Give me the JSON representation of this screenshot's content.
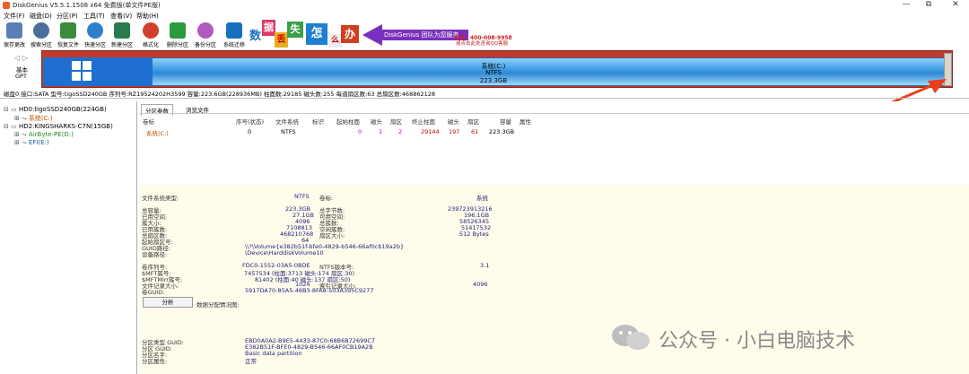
{
  "window": {
    "title": "DiskGenius V5.5.1.1508 x64 免费版(单文件PE版)",
    "minimize": "—",
    "restore": "⧉",
    "close": "✕"
  },
  "menu": [
    "文件(F)",
    "磁盘(D)",
    "分区(P)",
    "工具(T)",
    "查看(V)",
    "帮助(H)"
  ],
  "toolbar": [
    {
      "label": "保存更改",
      "icon": "save-icon",
      "color": "#5a7fb8"
    },
    {
      "label": "搜索分区",
      "icon": "search-partition-icon",
      "color": "#4a6f9a"
    },
    {
      "label": "恢复文件",
      "icon": "recover-file-icon",
      "color": "#3c8a3c"
    },
    {
      "label": "快速分区",
      "icon": "quick-partition-icon",
      "color": "#2f7fcf"
    },
    {
      "label": "新建分区",
      "icon": "new-partition-icon",
      "color": "#2a7a50"
    },
    {
      "label": "格式化",
      "icon": "format-icon",
      "color": "#d0402a"
    },
    {
      "label": "删除分区",
      "icon": "delete-partition-icon",
      "color": "#2a9a3a"
    },
    {
      "label": "备份分区",
      "icon": "backup-partition-icon",
      "color": "#b05ac0"
    },
    {
      "label": "系统迁移",
      "icon": "system-migrate-icon",
      "color": "#1a70c0"
    }
  ],
  "ad": {
    "tiles": [
      "数",
      "据",
      "丢",
      "失",
      "怎",
      "么",
      "办"
    ],
    "tagline": "DiskGenius 团队为您服务",
    "phone": "电话：400-008-9958",
    "qq": "或点击此处咨询QQ客服"
  },
  "diskmap": {
    "label_top": "基本",
    "label_bottom": "GPT",
    "nav": "◁ ▷",
    "partition_name": "系统(C:)",
    "partition_fs": "NTFS",
    "partition_size": "223.3GB"
  },
  "diskinfo": "磁盘0 接口:SATA 型号:tigoSSD240GB 序列号:RZ19524202H3599 容量:223.6GB(228936MB) 柱面数:29185 磁头数:255 每道扇区数:63 总扇区数:468862128",
  "tree": {
    "disk0": "HD0:tigoSSD240GB(224GB)",
    "disk0_part": "系统(C:)",
    "disk2": "HD2:KINGSHARKS-C7N(15GB)",
    "disk2_part1": "AirByte-PE(D:)",
    "disk2_part2": "EFI(E:)"
  },
  "tabs": {
    "params": "分区参数",
    "browse": "浏览文件"
  },
  "columns": [
    "卷标",
    "序号(状态)",
    "文件系统",
    "标识",
    "起始柱面",
    "磁头",
    "扇区",
    "终止柱面",
    "磁头",
    "扇区",
    "容量",
    "属性"
  ],
  "row": {
    "name": "系统(C:)",
    "index": "0",
    "fs": "NTFS",
    "id": "",
    "start_cyl": "0",
    "start_head": "1",
    "start_sec": "2",
    "end_cyl": "29144",
    "end_head": "197",
    "end_sec": "61",
    "size": "223.3GB",
    "attr": ""
  },
  "info": {
    "fs_type_label": "文件系统类型:",
    "fs_type": "NTFS",
    "vol_label": "卷标:",
    "vol": "系统",
    "total_label": "总容量:",
    "total": "223.3GB",
    "total_bytes_label": "总字节数:",
    "total_bytes": "239723913216",
    "used_label": "已用空间:",
    "used": "27.1GB",
    "free_label": "可用空间:",
    "free": "196.1GB",
    "cluster_label": "簇大小:",
    "cluster": "4096",
    "clusters_label": "总簇数:",
    "clusters": "58526345",
    "used_clusters_label": "已用簇数:",
    "used_clusters": "7108813",
    "free_clusters_label": "空闲簇数:",
    "free_clusters": "51417532",
    "sectors_label": "总扇区数:",
    "sectors": "468210768",
    "sector_size_label": "扇区大小:",
    "sector_size": "512 Bytes",
    "start_sector_label": "起始扇区号:",
    "start_sector": "64",
    "guid_path_label": "GUID路径:",
    "guid_path": "\\\\?\\Volume{e382b51f-bfe0-4829-b546-66af0cb19a2b}",
    "device_path_label": "设备路径:",
    "device_path": "\\Device\\HarddiskVolume10",
    "serial_label": "卷序列号:",
    "serial": "FDC0-1552-03A5-0BDE",
    "ntfs_ver_label": "NTFS版本号:",
    "ntfs_ver": "3.1",
    "mft_label": "$MFT簇号:",
    "mft": "7457534 (柱面:3713 磁头:174 扇区:30)",
    "mftmirr_label": "$MFTMirr簇号:",
    "mftmirr": "81402 (柱面:40 磁头:137 扇区:50)",
    "frs_label": "文件记录大小:",
    "frs": "1024",
    "index_label": "索引记录大小:",
    "index": "4096",
    "volguid_label": "卷GUID:",
    "volguid": "5917DA70-85A5-46B3-8FA8-503A395C9277",
    "analyze_button": "分析",
    "dist_label": "数据分配情况图:",
    "ptype_guid_label": "分区类型 GUID:",
    "ptype_guid": "EBD0A0A2-B9E5-4433-87C0-68B6B72699C7",
    "pguid_label": "分区 GUID:",
    "pguid": "E382B51F-BFE0-4829-B546-66AF0CB19A2B",
    "pname_label": "分区名字:",
    "pname": "Basic data partition",
    "pattr_label": "分区属性:",
    "pattr": "正常"
  },
  "watermark": "公众号 · 小白电脑技术",
  "colors": {
    "accent": "#7b2fbe",
    "arrow": "#e8401c",
    "disk_border": "#c0392b",
    "partition_fill": "#4aa8ea",
    "value_text": "#21217a"
  }
}
